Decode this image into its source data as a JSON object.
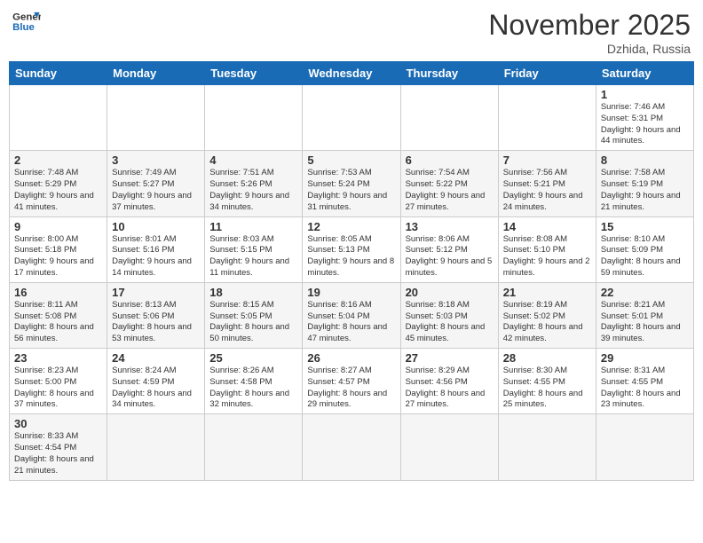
{
  "header": {
    "logo_general": "General",
    "logo_blue": "Blue",
    "month": "November 2025",
    "location": "Dzhida, Russia"
  },
  "days_of_week": [
    "Sunday",
    "Monday",
    "Tuesday",
    "Wednesday",
    "Thursday",
    "Friday",
    "Saturday"
  ],
  "weeks": [
    [
      {
        "day": "",
        "info": ""
      },
      {
        "day": "",
        "info": ""
      },
      {
        "day": "",
        "info": ""
      },
      {
        "day": "",
        "info": ""
      },
      {
        "day": "",
        "info": ""
      },
      {
        "day": "",
        "info": ""
      },
      {
        "day": "1",
        "info": "Sunrise: 7:46 AM\nSunset: 5:31 PM\nDaylight: 9 hours\nand 44 minutes."
      }
    ],
    [
      {
        "day": "2",
        "info": "Sunrise: 7:48 AM\nSunset: 5:29 PM\nDaylight: 9 hours\nand 41 minutes."
      },
      {
        "day": "3",
        "info": "Sunrise: 7:49 AM\nSunset: 5:27 PM\nDaylight: 9 hours\nand 37 minutes."
      },
      {
        "day": "4",
        "info": "Sunrise: 7:51 AM\nSunset: 5:26 PM\nDaylight: 9 hours\nand 34 minutes."
      },
      {
        "day": "5",
        "info": "Sunrise: 7:53 AM\nSunset: 5:24 PM\nDaylight: 9 hours\nand 31 minutes."
      },
      {
        "day": "6",
        "info": "Sunrise: 7:54 AM\nSunset: 5:22 PM\nDaylight: 9 hours\nand 27 minutes."
      },
      {
        "day": "7",
        "info": "Sunrise: 7:56 AM\nSunset: 5:21 PM\nDaylight: 9 hours\nand 24 minutes."
      },
      {
        "day": "8",
        "info": "Sunrise: 7:58 AM\nSunset: 5:19 PM\nDaylight: 9 hours\nand 21 minutes."
      }
    ],
    [
      {
        "day": "9",
        "info": "Sunrise: 8:00 AM\nSunset: 5:18 PM\nDaylight: 9 hours\nand 17 minutes."
      },
      {
        "day": "10",
        "info": "Sunrise: 8:01 AM\nSunset: 5:16 PM\nDaylight: 9 hours\nand 14 minutes."
      },
      {
        "day": "11",
        "info": "Sunrise: 8:03 AM\nSunset: 5:15 PM\nDaylight: 9 hours\nand 11 minutes."
      },
      {
        "day": "12",
        "info": "Sunrise: 8:05 AM\nSunset: 5:13 PM\nDaylight: 9 hours\nand 8 minutes."
      },
      {
        "day": "13",
        "info": "Sunrise: 8:06 AM\nSunset: 5:12 PM\nDaylight: 9 hours\nand 5 minutes."
      },
      {
        "day": "14",
        "info": "Sunrise: 8:08 AM\nSunset: 5:10 PM\nDaylight: 9 hours\nand 2 minutes."
      },
      {
        "day": "15",
        "info": "Sunrise: 8:10 AM\nSunset: 5:09 PM\nDaylight: 8 hours\nand 59 minutes."
      }
    ],
    [
      {
        "day": "16",
        "info": "Sunrise: 8:11 AM\nSunset: 5:08 PM\nDaylight: 8 hours\nand 56 minutes."
      },
      {
        "day": "17",
        "info": "Sunrise: 8:13 AM\nSunset: 5:06 PM\nDaylight: 8 hours\nand 53 minutes."
      },
      {
        "day": "18",
        "info": "Sunrise: 8:15 AM\nSunset: 5:05 PM\nDaylight: 8 hours\nand 50 minutes."
      },
      {
        "day": "19",
        "info": "Sunrise: 8:16 AM\nSunset: 5:04 PM\nDaylight: 8 hours\nand 47 minutes."
      },
      {
        "day": "20",
        "info": "Sunrise: 8:18 AM\nSunset: 5:03 PM\nDaylight: 8 hours\nand 45 minutes."
      },
      {
        "day": "21",
        "info": "Sunrise: 8:19 AM\nSunset: 5:02 PM\nDaylight: 8 hours\nand 42 minutes."
      },
      {
        "day": "22",
        "info": "Sunrise: 8:21 AM\nSunset: 5:01 PM\nDaylight: 8 hours\nand 39 minutes."
      }
    ],
    [
      {
        "day": "23",
        "info": "Sunrise: 8:23 AM\nSunset: 5:00 PM\nDaylight: 8 hours\nand 37 minutes."
      },
      {
        "day": "24",
        "info": "Sunrise: 8:24 AM\nSunset: 4:59 PM\nDaylight: 8 hours\nand 34 minutes."
      },
      {
        "day": "25",
        "info": "Sunrise: 8:26 AM\nSunset: 4:58 PM\nDaylight: 8 hours\nand 32 minutes."
      },
      {
        "day": "26",
        "info": "Sunrise: 8:27 AM\nSunset: 4:57 PM\nDaylight: 8 hours\nand 29 minutes."
      },
      {
        "day": "27",
        "info": "Sunrise: 8:29 AM\nSunset: 4:56 PM\nDaylight: 8 hours\nand 27 minutes."
      },
      {
        "day": "28",
        "info": "Sunrise: 8:30 AM\nSunset: 4:55 PM\nDaylight: 8 hours\nand 25 minutes."
      },
      {
        "day": "29",
        "info": "Sunrise: 8:31 AM\nSunset: 4:55 PM\nDaylight: 8 hours\nand 23 minutes."
      }
    ],
    [
      {
        "day": "30",
        "info": "Sunrise: 8:33 AM\nSunset: 4:54 PM\nDaylight: 8 hours\nand 21 minutes."
      },
      {
        "day": "",
        "info": ""
      },
      {
        "day": "",
        "info": ""
      },
      {
        "day": "",
        "info": ""
      },
      {
        "day": "",
        "info": ""
      },
      {
        "day": "",
        "info": ""
      },
      {
        "day": "",
        "info": ""
      }
    ]
  ]
}
